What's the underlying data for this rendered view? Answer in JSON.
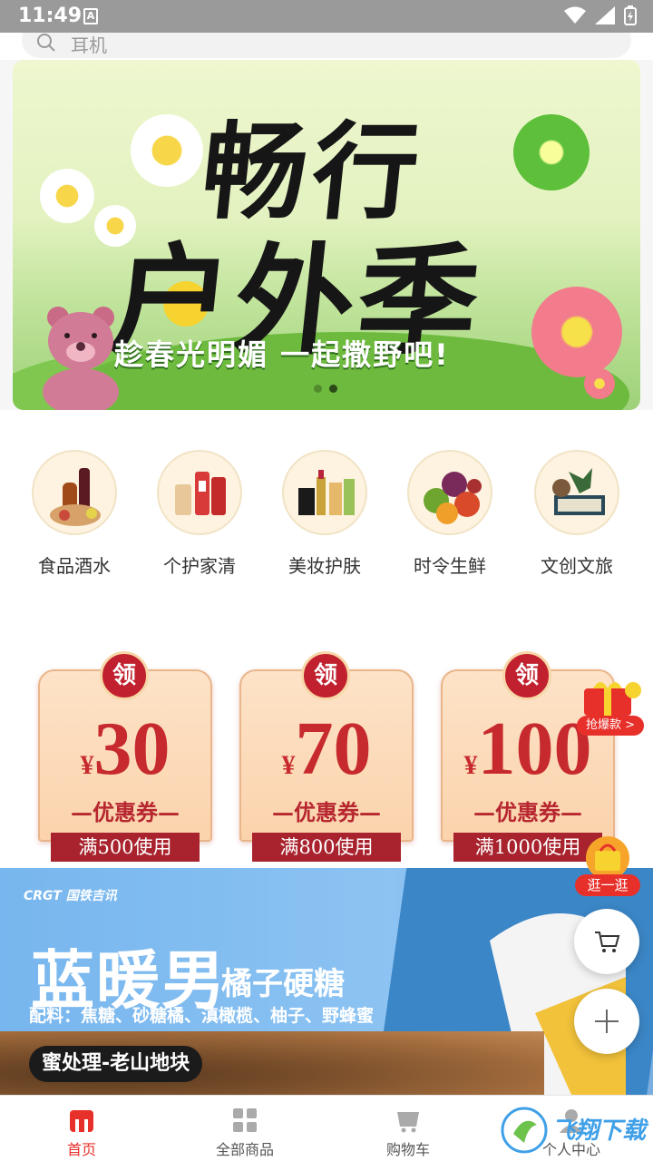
{
  "status_bar": {
    "time": "11:49",
    "notification_glyph": "A"
  },
  "search": {
    "placeholder": "耳机"
  },
  "banner": {
    "title_line1": "畅行",
    "title_line2": "户外季",
    "subtitle": "趁春光明媚 一起撒野吧!",
    "slide_count": 2,
    "active_slide": 2
  },
  "categories": [
    {
      "label": "食品酒水",
      "icon": "food-wine-icon"
    },
    {
      "label": "个护家清",
      "icon": "personal-care-icon"
    },
    {
      "label": "美妆护肤",
      "icon": "cosmetics-icon"
    },
    {
      "label": "时令生鲜",
      "icon": "fresh-fruit-icon"
    },
    {
      "label": "文创文旅",
      "icon": "cultural-creative-icon"
    }
  ],
  "coupons": [
    {
      "badge": "领",
      "currency": "¥",
      "amount": "30",
      "type": "—优惠券—",
      "condition": "满500使用"
    },
    {
      "badge": "领",
      "currency": "¥",
      "amount": "70",
      "type": "—优惠券—",
      "condition": "满800使用"
    },
    {
      "badge": "领",
      "currency": "¥",
      "amount": "100",
      "type": "—优惠券—",
      "condition": "满1000使用"
    }
  ],
  "floating": {
    "gift_label": "抢爆款 >",
    "shop_label": "逛一逛"
  },
  "product_banner": {
    "brand": "CRGT 国铁吉讯",
    "title": "蓝暖男",
    "title2": "橘子硬糖",
    "ingredients": "配料：焦糖、砂糖橘、滇橄榄、柚子、野蜂蜜",
    "tag": "蜜处理-老山地块"
  },
  "bottom_nav": [
    {
      "label": "首页",
      "icon": "home-icon",
      "active": true
    },
    {
      "label": "全部商品",
      "icon": "grid-icon",
      "active": false
    },
    {
      "label": "购物车",
      "icon": "cart-icon",
      "active": false
    },
    {
      "label": "个人中心",
      "icon": "user-icon",
      "active": false
    }
  ],
  "watermark": {
    "text": "飞翔下载"
  },
  "colors": {
    "accent": "#e8302b",
    "coupon_red": "#c72a2e",
    "product_blue": "#7ab6ee"
  }
}
